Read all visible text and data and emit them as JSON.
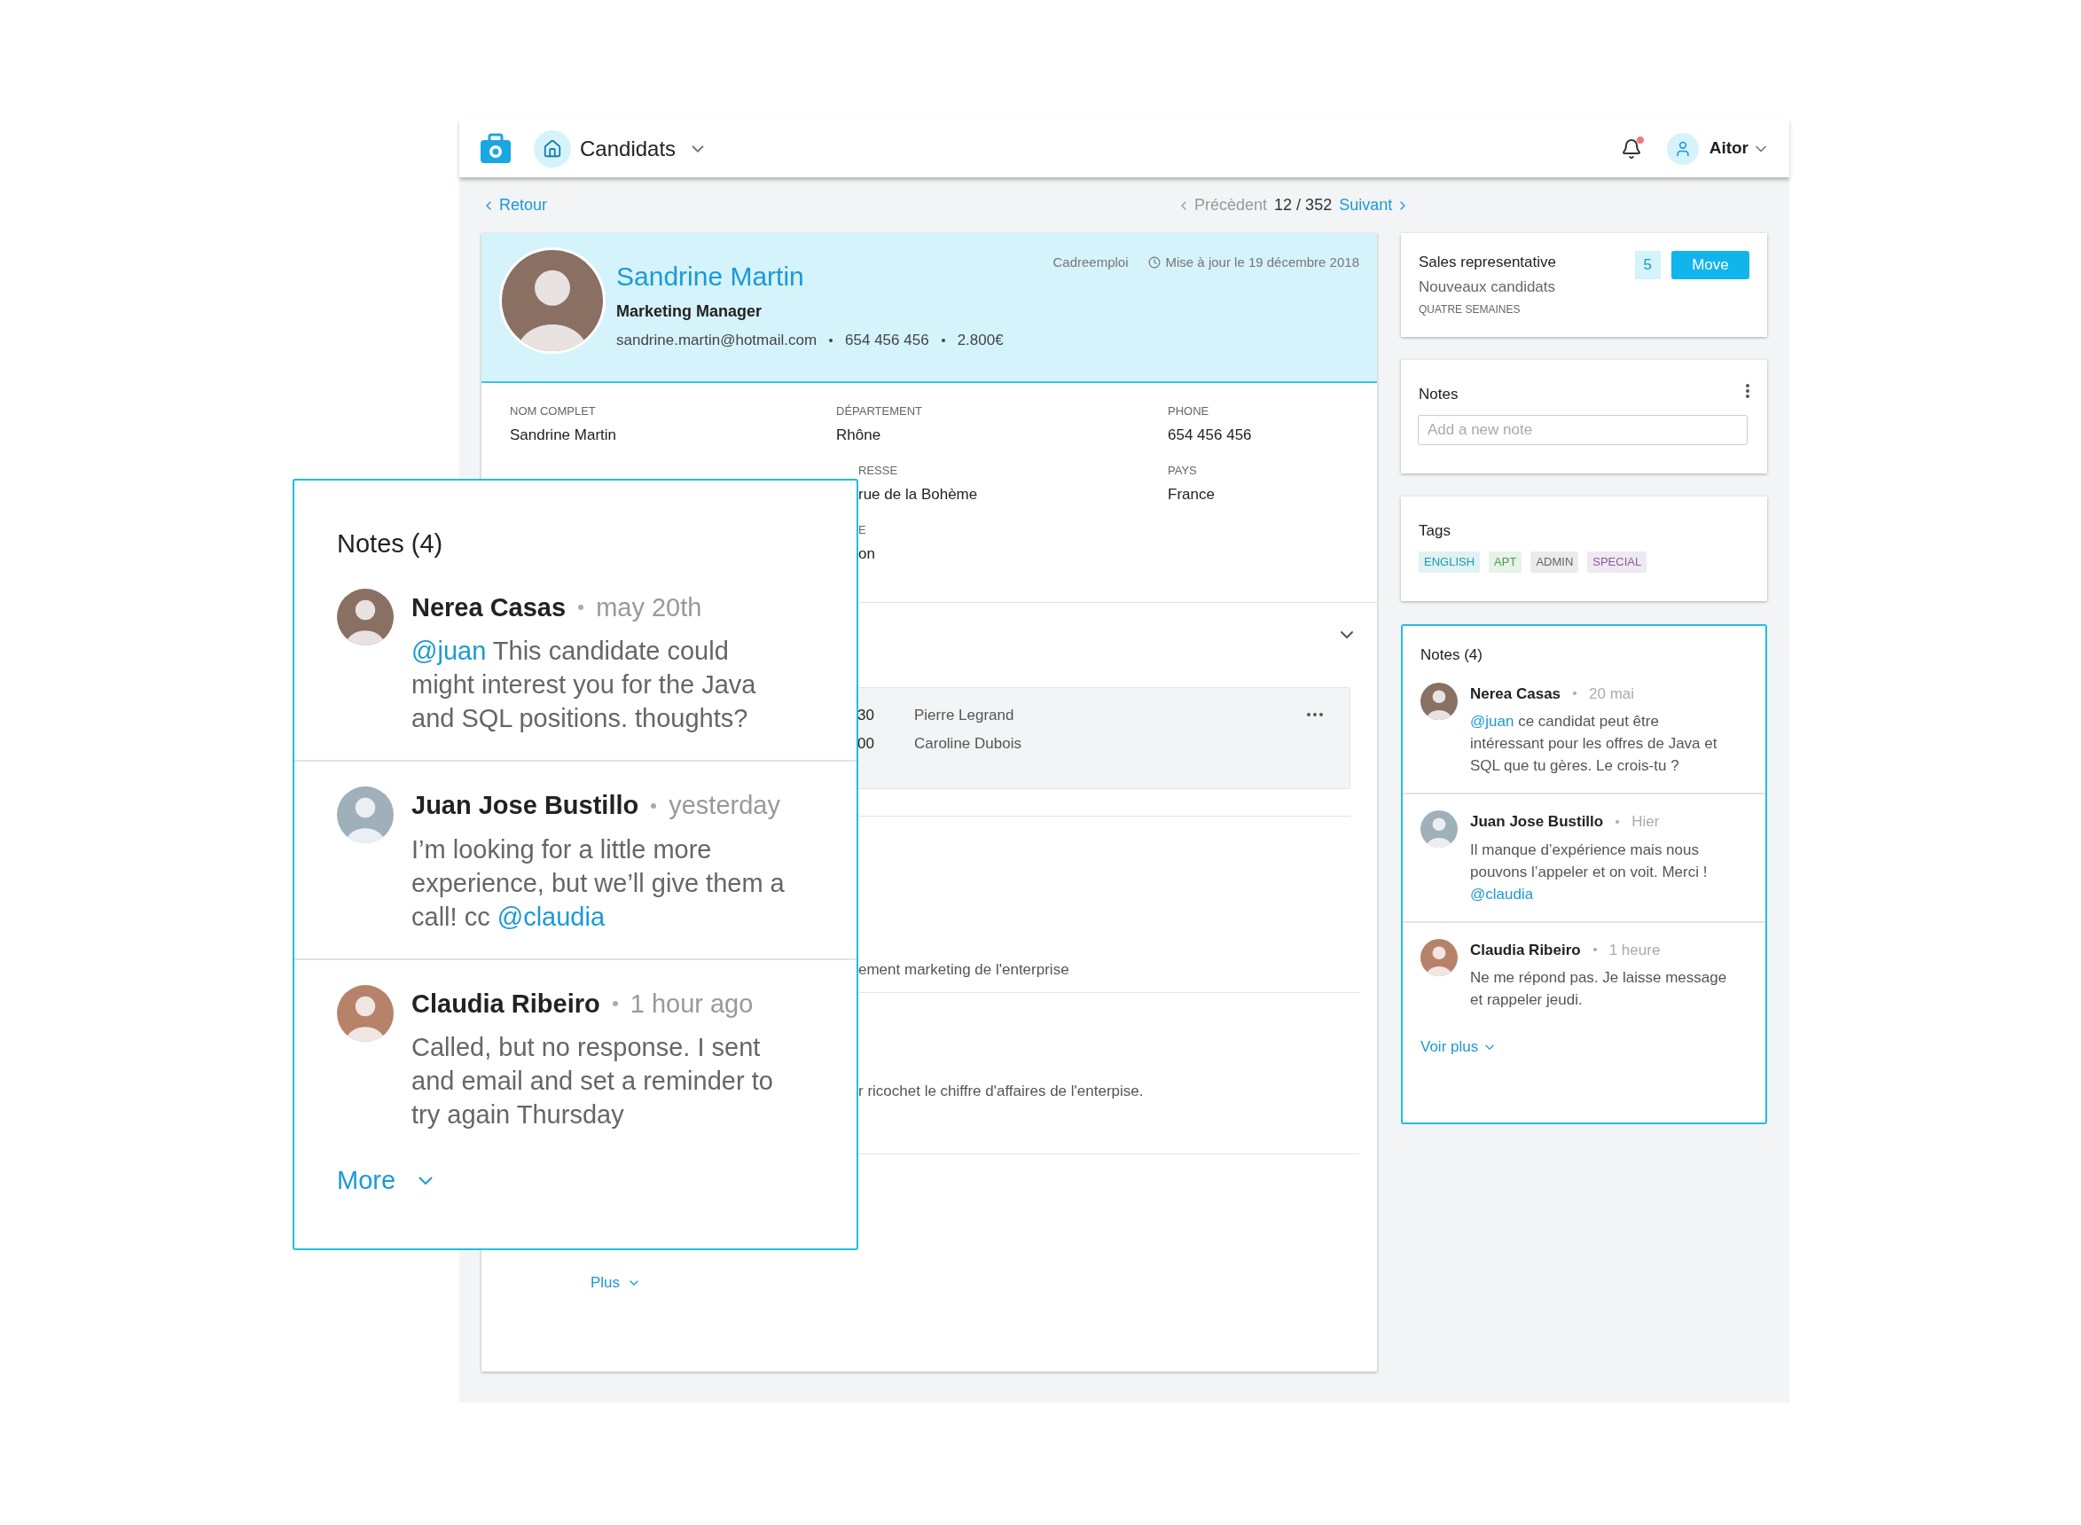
{
  "top_bar": {
    "section": "Candidats",
    "user": "Aitor",
    "notifications_unread": true
  },
  "nav": {
    "back": "Retour",
    "previous": "Précèdent",
    "position": "12 / 352",
    "next": "Suivant"
  },
  "candidate": {
    "name": "Sandrine Martin",
    "title": "Marketing Manager",
    "email": "sandrine.martin@hotmail.com",
    "phone": "654 456 456",
    "salary": "2.800€",
    "source": "Cadreemploi",
    "updated": "Mise à jour le 19 décembre 2018"
  },
  "fields": [
    {
      "label": "NOM COMPLET",
      "value": "Sandrine Martin",
      "covered": false
    },
    {
      "label": "DÉPARTEMENT",
      "value": "Rhône",
      "covered": false
    },
    {
      "label": "PHONE",
      "value": "654 456 456",
      "covered": false
    },
    {
      "label": "RESSE",
      "value": "rue de la Bohème",
      "covered": true
    },
    {
      "label": "PAYS",
      "value": "France",
      "covered": false
    },
    {
      "label": "E",
      "value": "on",
      "covered": true
    }
  ],
  "meetings": [
    {
      "time": "30",
      "name": "Pierre Legrand"
    },
    {
      "time": "00",
      "name": "Caroline Dubois"
    }
  ],
  "descriptions": [
    "ement marketing de l'enterprise",
    "r ricochet le chiffre d'affaires de l'enterpise."
  ],
  "more": "Plus",
  "pipeline": {
    "job": "Sales representative",
    "stage": "Nouveaux candidats",
    "duration": "QUATRE SEMAINES",
    "count": "5",
    "action": "Move"
  },
  "notes_input": {
    "title": "Notes",
    "placeholder": "Add a new note"
  },
  "tags": {
    "title": "Tags",
    "items": [
      {
        "label": "ENGLISH",
        "color": "#1a9ab0"
      },
      {
        "label": "APT",
        "color": "#4a9a5a"
      },
      {
        "label": "ADMIN",
        "color": "#666666"
      },
      {
        "label": "SPECIAL",
        "color": "#8a5a9a"
      }
    ]
  },
  "notes_fr": {
    "title": "Notes (4)",
    "more": "Voir plus",
    "items": [
      {
        "author": "Nerea Casas",
        "time": "20 mai",
        "parts": [
          {
            "kind": "mention",
            "text": "@juan"
          },
          {
            "kind": "text",
            "text": " ce candidat peut être intéressant pour les offres de Java et SQL que tu gères. Le crois-tu ?"
          }
        ]
      },
      {
        "author": "Juan Jose Bustillo",
        "time": "Hier",
        "parts": [
          {
            "kind": "text",
            "text": "Il manque d’expérience mais nous pouvons l’appeler et on voit. Merci ! "
          },
          {
            "kind": "mention",
            "text": "@claudia"
          }
        ]
      },
      {
        "author": "Claudia Ribeiro",
        "time": "1 heure",
        "parts": [
          {
            "kind": "text",
            "text": "Ne me répond pas. Je laisse message et rappeler jeudi."
          }
        ]
      }
    ]
  },
  "notes_en": {
    "title": "Notes (4)",
    "more": "More",
    "items": [
      {
        "author": "Nerea Casas",
        "time": "may 20th",
        "parts": [
          {
            "kind": "mention",
            "text": "@juan"
          },
          {
            "kind": "text",
            "text": " This candidate could might interest you for the Java and SQL positions. thoughts?"
          }
        ]
      },
      {
        "author": "Juan Jose Bustillo",
        "time": "yesterday",
        "parts": [
          {
            "kind": "text",
            "text": "I’m looking for a little more experience, but we’ll give them a call! cc "
          },
          {
            "kind": "mention",
            "text": "@claudia"
          }
        ]
      },
      {
        "author": "Claudia Ribeiro",
        "time": "1 hour ago",
        "parts": [
          {
            "kind": "text",
            "text": "Called, but no response. I sent and email and set a reminder to try again Thursday"
          }
        ]
      }
    ]
  }
}
